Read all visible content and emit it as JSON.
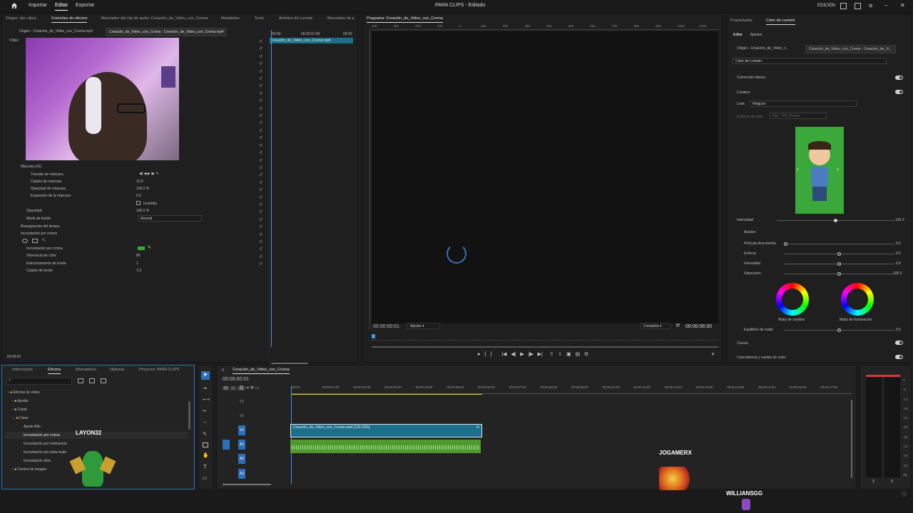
{
  "topbar": {
    "home_icon": "home-icon",
    "importar": "Importar",
    "editar": "Editar",
    "exportar": "Exportar",
    "title": "PARA CLIPS",
    "status": "Editado",
    "edicion": "EDICIÓN"
  },
  "source_panel": {
    "tabs": [
      "Origen: (sin clips)",
      "Controles de efectos",
      "Mezclador del clip de audio: Creación_de_Video_con_Croma",
      "Metadatos",
      "Texto",
      "Ámbitos de Lumetri",
      "Mezclador de p"
    ],
    "clip_tabs": [
      "Origen - Creación_de_Video_con_Croma.mp4",
      "Creación_de_Video_con_Croma - Creación_de_Video_con_Croma.mp4"
    ],
    "section_video": "Vídeo",
    "timecode_start": "00:00",
    "timecode_mid": "00:00:01:00",
    "timecode_end": "00:00",
    "clip_label": "Creación_de_Video_con_Croma.mp4",
    "mask_header": "Máscara (01)",
    "mask_path": "Trazado de máscara",
    "rows": [
      {
        "label": "Calado de máscara",
        "value": "10.0"
      },
      {
        "label": "Opacidad de máscara",
        "value": "100.0 %"
      },
      {
        "label": "Expansión de la máscara",
        "value": "0.0"
      }
    ],
    "invertido": "Invertido",
    "opacidad": "Opacidad",
    "opacidad_value": "100.0 %",
    "modo_fusion": "Modo de fusión",
    "modo_value": "Normal",
    "remap": "Reasignación del tiempo",
    "croma_header": "Incrustación por croma",
    "croma_rows": [
      {
        "label": "Incrustación por croma",
        "value": ""
      },
      {
        "label": "Tolerancia de color",
        "value": "80"
      },
      {
        "label": "Estrechamiento de borde",
        "value": "1"
      },
      {
        "label": "Calado de borde",
        "value": "1.9"
      }
    ],
    "bottom_timecode": "00:00:01"
  },
  "program": {
    "title": "Programa: Creación_de_Video_con_Croma",
    "ruler": [
      "400",
      "300",
      "200",
      "100",
      "0",
      "100",
      "200",
      "300",
      "400",
      "500",
      "600",
      "700",
      "800",
      "900",
      "1000",
      "1100"
    ],
    "timecode": "00:00:00:01",
    "fit": "Ajustar",
    "quality": "Completa",
    "duration": "00:00:06:00"
  },
  "lumetri": {
    "tabs": [
      "Propiedades",
      "Color de Lumetri"
    ],
    "subtabs": [
      "Editar",
      "Ajustes"
    ],
    "clip_tabs": [
      "Origen - Creación_de_Video_c...",
      "Creación_de_Video_con_Croma - Creación_de_Vi..."
    ],
    "preset": "Color de Lumetri",
    "basic": "Corrección básica",
    "creative": "Creativo",
    "look_label": "Look",
    "look_value": "Ninguno",
    "colorspace_label": "Espacio de color",
    "colorspace_value": "Rec. 709 (Scene)",
    "intensidad": "Intensidad",
    "intensidad_value": "100.0",
    "ajustes": "Ajustes",
    "sliders": [
      {
        "label": "Película descolorida",
        "value": "0.0"
      },
      {
        "label": "Enfocar",
        "value": "0.0"
      },
      {
        "label": "Intensidad",
        "value": "0.0"
      },
      {
        "label": "Saturación",
        "value": "100.0"
      }
    ],
    "shadow_tint": "Matiz de sombra",
    "highlight_tint": "Matiz de iluminación",
    "balance": "Equilibrio de matiz",
    "balance_value": "0.0",
    "curves": "Curvas",
    "match": "Coincidencia y ruedas de color"
  },
  "project": {
    "tabs": [
      "Información",
      "Efectos",
      "Marcadores",
      "Historial",
      "Proyecto: PARA CLIPS"
    ],
    "tree": [
      {
        "label": "Efectos de vídeo",
        "level": 0
      },
      {
        "label": "Ajustar",
        "level": 1
      },
      {
        "label": "Canal",
        "level": 1
      },
      {
        "label": "Clave",
        "level": 1
      },
      {
        "label": "Ajuste Alfa",
        "level": 2
      },
      {
        "label": "Incrustación por croma",
        "level": 2
      },
      {
        "label": "Incrustación por luminancia",
        "level": 2
      },
      {
        "label": "Incrustación por pista mate",
        "level": 2
      },
      {
        "label": "Incrustación ultra",
        "level": 2
      },
      {
        "label": "Control de imagen",
        "level": 1
      }
    ]
  },
  "timeline": {
    "title": "Creación_de_Video_con_Croma",
    "timecode": "00:00:00:01",
    "ruler": [
      ":00:00",
      "00:00:01:00",
      "00:00:02:00",
      "00:00:03:00",
      "00:00:04:00",
      "00:00:05:00",
      "00:00:06:00",
      "00:00:07:00",
      "00:00:08:00",
      "00:00:09:00",
      "00:00:10:00",
      "00:00:11:00",
      "00:00:12:00",
      "00:00:13:00",
      "00:00:14:00",
      "00:00:15:00",
      "00:00:16:00",
      "00:00:17:00"
    ],
    "tracks": [
      "V3",
      "V2",
      "V1",
      "A1",
      "A2",
      "A3"
    ],
    "clip_label": "Creación_de_Video_con_Croma.mp4 [133.33%]"
  },
  "meters": [
    "0",
    "-6",
    "-12",
    "-18",
    "-24",
    "-30",
    "-36",
    "-42",
    "-48",
    "-54",
    "dB"
  ],
  "meter_foot": [
    "S",
    "S"
  ],
  "overlay": {
    "name1": "LAYON32",
    "name2": "JOGAMERX",
    "name3": "WILLIANSGG"
  },
  "colors": {
    "accent": "#2d8ceb",
    "clip_video": "#1b6f8a",
    "clip_audio": "#4e9a2e",
    "green_screen": "#3aa83a"
  }
}
